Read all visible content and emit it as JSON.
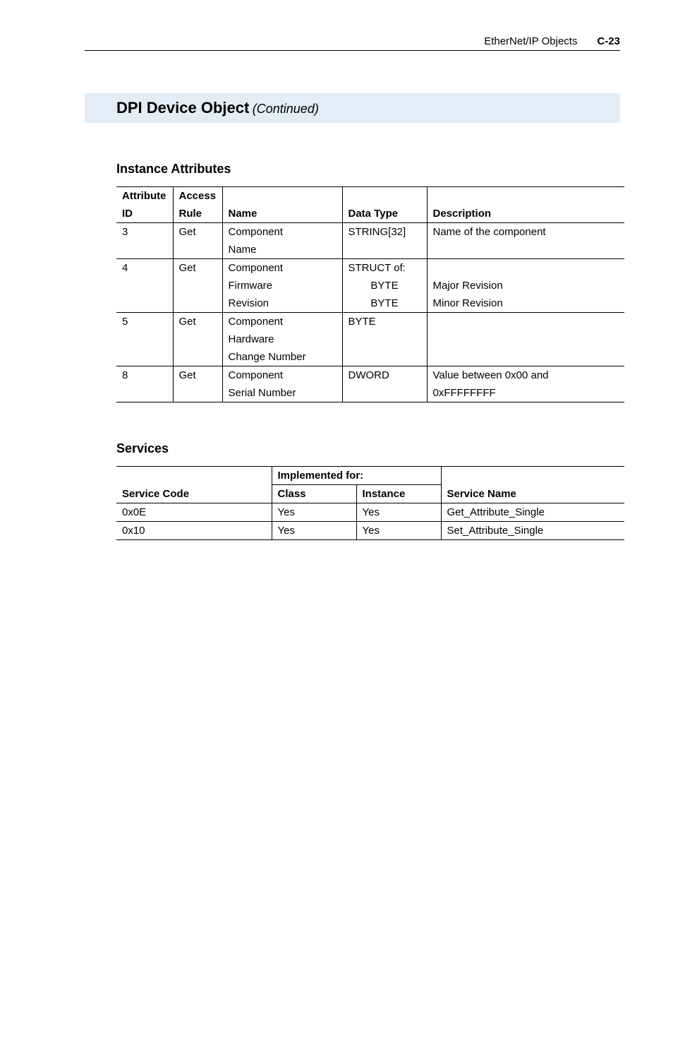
{
  "header": {
    "section": "EtherNet/IP Objects",
    "page": "C-23"
  },
  "title": {
    "main": "DPI Device Object",
    "sub": "(Continued)"
  },
  "instance": {
    "heading": "Instance Attributes",
    "columns": {
      "c1a": "Attribute",
      "c1b": "ID",
      "c2a": "Access",
      "c2b": "Rule",
      "c3": "Name",
      "c4": "Data Type",
      "c5": "Description"
    },
    "rows": [
      {
        "id": "3",
        "rule": "Get",
        "name": [
          "Component",
          "Name"
        ],
        "type": [
          "STRING[32]"
        ],
        "desc": [
          "Name of the component"
        ]
      },
      {
        "id": "4",
        "rule": "Get",
        "name": [
          "Component",
          "Firmware",
          "Revision"
        ],
        "type": [
          "STRUCT of:",
          "BYTE",
          "BYTE"
        ],
        "type_align": [
          "left",
          "center",
          "center"
        ],
        "desc": [
          "",
          "Major Revision",
          "Minor Revision"
        ]
      },
      {
        "id": "5",
        "rule": "Get",
        "name": [
          "Component",
          "Hardware",
          "Change Number"
        ],
        "type": [
          "BYTE"
        ],
        "desc": [
          ""
        ]
      },
      {
        "id": "8",
        "rule": "Get",
        "name": [
          "Component",
          "Serial Number"
        ],
        "type": [
          "DWORD"
        ],
        "desc": [
          "Value between 0x00 and",
          "0xFFFFFFFF"
        ]
      }
    ]
  },
  "services": {
    "heading": "Services",
    "columns": {
      "c1": "Service Code",
      "grp": "Implemented for:",
      "c2": "Class",
      "c3": "Instance",
      "c4": "Service Name"
    },
    "rows": [
      {
        "code": "0x0E",
        "cls": "Yes",
        "inst": "Yes",
        "name": "Get_Attribute_Single"
      },
      {
        "code": "0x10",
        "cls": "Yes",
        "inst": "Yes",
        "name": "Set_Attribute_Single"
      }
    ]
  }
}
